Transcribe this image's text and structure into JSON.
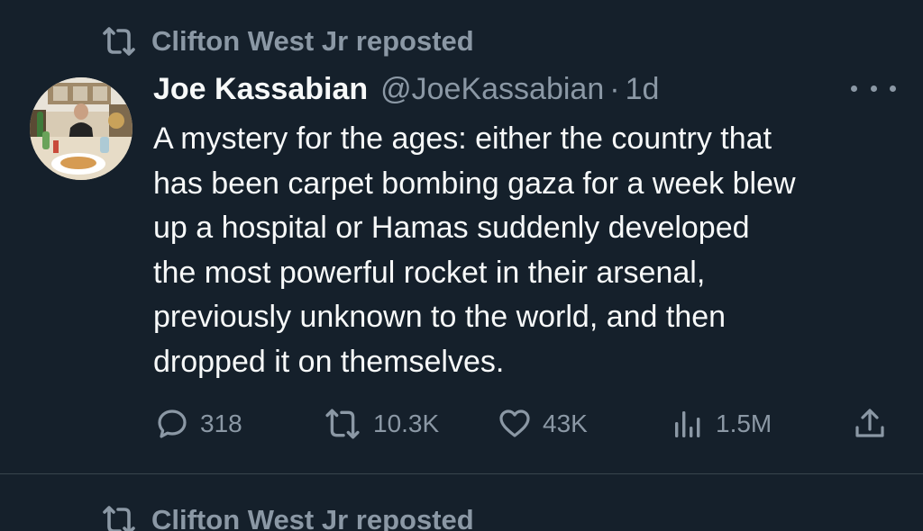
{
  "reposter": {
    "label": "Clifton West Jr reposted",
    "icon": "repost-icon"
  },
  "tweet": {
    "author_name": "Joe Kassabian",
    "author_handle": "@JoeKassabian",
    "separator": "·",
    "time": "1d",
    "text_lines": [
      "A mystery for the ages: either the country that",
      "has been carpet bombing gaza for a week blew",
      "up a hospital or Hamas suddenly developed",
      "the most powerful rocket in their arsenal,",
      "previously unknown to the world, and then",
      "dropped it on themselves."
    ],
    "replies": "318",
    "reposts": "10.3K",
    "likes": "43K",
    "views": "1.5M"
  },
  "next_reposter": {
    "label": "Clifton West Jr reposted"
  },
  "colors": {
    "background": "#15202b",
    "text": "#f7f9f9",
    "muted": "#8b98a5",
    "divider": "#38444d"
  }
}
